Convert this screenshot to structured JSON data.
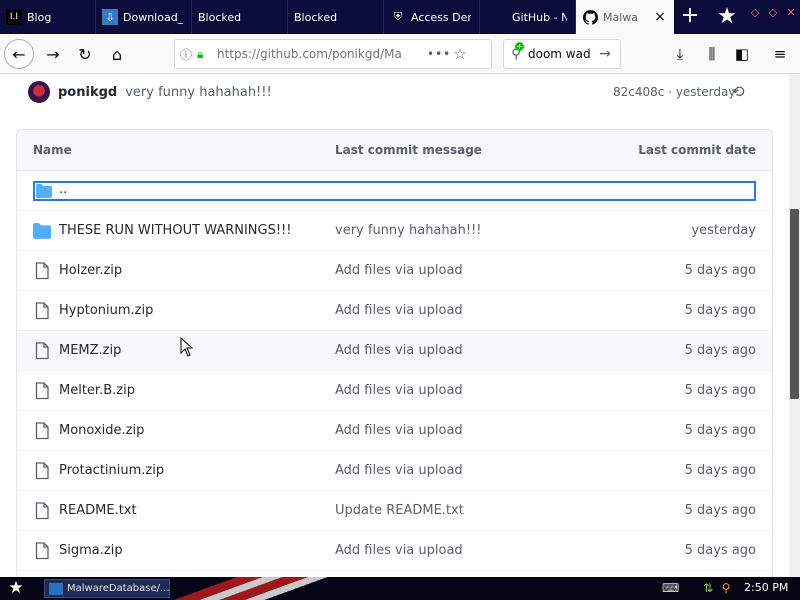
{
  "tabs": [
    {
      "title": "Blog"
    },
    {
      "title": "Download_"
    },
    {
      "title": "Blocked"
    },
    {
      "title": "Blocked"
    },
    {
      "title": "Access Der"
    },
    {
      "title": "GitHub - NS"
    },
    {
      "title": "Malwa"
    }
  ],
  "address_bar": {
    "url": "https://github.com/ponikgd/Ma",
    "more": "•••"
  },
  "search_bar": {
    "value": "doom wad"
  },
  "latest_commit": {
    "author": "ponikgd",
    "message": "very funny hahahah!!!",
    "sha_time": "82c408c · yesterday"
  },
  "table": {
    "headers": {
      "name": "Name",
      "message": "Last commit message",
      "date": "Last commit date"
    },
    "parent_dir": "..",
    "rows": [
      {
        "type": "folder",
        "name": "THESE RUN WITHOUT WARNINGS!!!",
        "message": "very funny hahahah!!!",
        "date": "yesterday"
      },
      {
        "type": "file",
        "name": "Holzer.zip",
        "message": "Add files via upload",
        "date": "5 days ago"
      },
      {
        "type": "file",
        "name": "Hyptonium.zip",
        "message": "Add files via upload",
        "date": "5 days ago"
      },
      {
        "type": "file",
        "name": "MEMZ.zip",
        "message": "Add files via upload",
        "date": "5 days ago"
      },
      {
        "type": "file",
        "name": "Melter.B.zip",
        "message": "Add files via upload",
        "date": "5 days ago"
      },
      {
        "type": "file",
        "name": "Monoxide.zip",
        "message": "Add files via upload",
        "date": "5 days ago"
      },
      {
        "type": "file",
        "name": "Protactinium.zip",
        "message": "Add files via upload",
        "date": "5 days ago"
      },
      {
        "type": "file",
        "name": "README.txt",
        "message": "Update README.txt",
        "date": "5 days ago"
      },
      {
        "type": "file",
        "name": "Sigma.zip",
        "message": "Add files via upload",
        "date": "5 days ago"
      }
    ]
  },
  "taskbar": {
    "window_title": "MalwareDatabase/...",
    "clock": "2:50 PM"
  },
  "colors": {
    "tabstrip": "#0c0c3a",
    "folder": "#54aeff",
    "focus_outline": "#2b7bd6",
    "secure_lock": "#12bc00"
  }
}
